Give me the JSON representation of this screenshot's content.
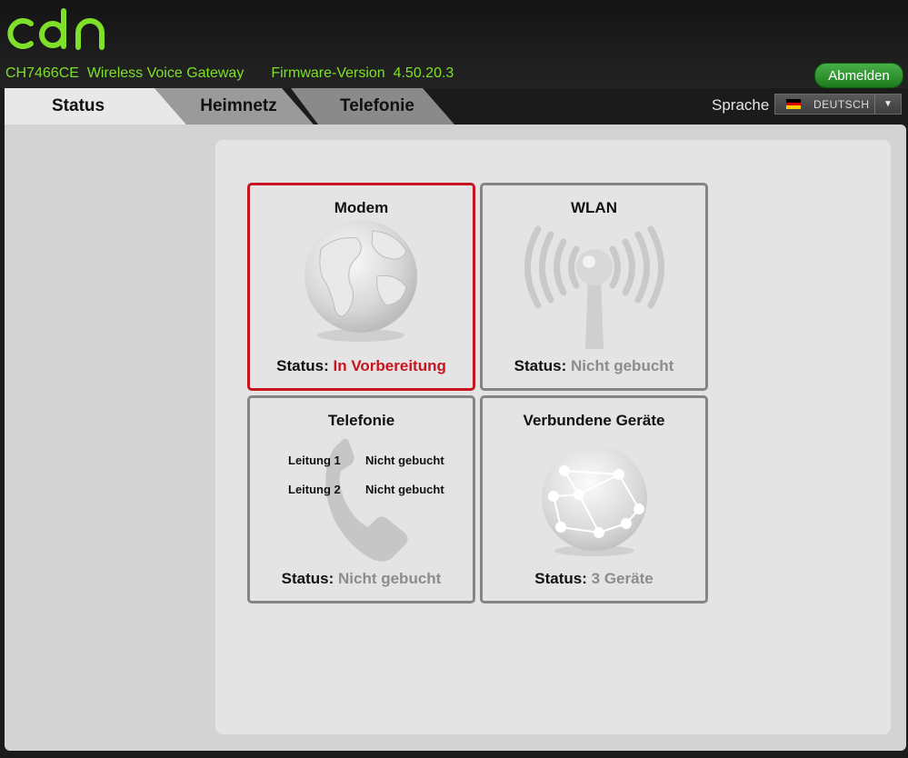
{
  "header": {
    "logo_text": "cbn",
    "device_name": "CH7466CE  Wireless Voice Gateway",
    "firmware": "Firmware-Version  4.50.20.3",
    "logout_label": "Abmelden"
  },
  "tabs": [
    {
      "label": "Status",
      "active": true
    },
    {
      "label": "Heimnetz",
      "active": false
    },
    {
      "label": "Telefonie",
      "active": false
    }
  ],
  "language": {
    "label": "Sprache",
    "selected": "DEUTSCH",
    "flag_colors": [
      "#000000",
      "#dd0000",
      "#ffce00"
    ]
  },
  "tiles": {
    "modem": {
      "title": "Modem",
      "status_label": "Status:",
      "status_value": "In Vorbereitung",
      "icon": "globe-icon"
    },
    "wlan": {
      "title": "WLAN",
      "status_label": "Status:",
      "status_value": "Nicht gebucht",
      "icon": "wifi-antenna-icon"
    },
    "telefonie": {
      "title": "Telefonie",
      "status_label": "Status:",
      "status_value": "Nicht gebucht",
      "icon": "phone-handset-icon",
      "lines": [
        {
          "label": "Leitung 1",
          "value": "Nicht gebucht"
        },
        {
          "label": "Leitung 2",
          "value": "Nicht gebucht"
        }
      ]
    },
    "devices": {
      "title": "Verbundene Geräte",
      "status_label": "Status:",
      "status_value": "3 Geräte",
      "icon": "network-globe-icon"
    }
  },
  "colors": {
    "accent_green": "#7fe02a",
    "alert_red": "#c8141e",
    "muted_gray": "#8c8c8c"
  }
}
